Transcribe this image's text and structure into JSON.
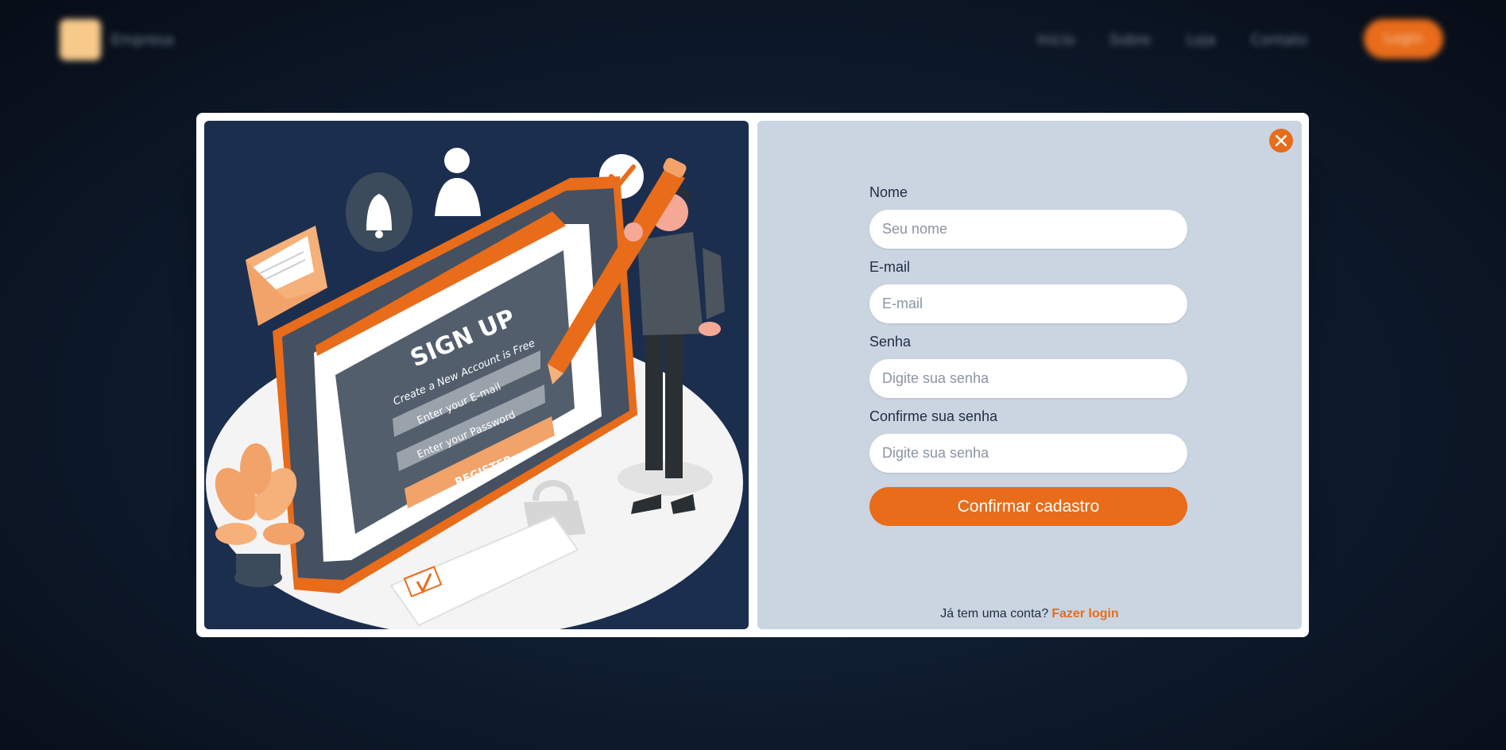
{
  "background_nav": {
    "brand": "Empresa",
    "links": [
      "Início",
      "Sobre",
      "Loja",
      "Contato"
    ],
    "login_label": "Login"
  },
  "illustration": {
    "heading": "SIGN UP",
    "subheading": "Create a New Account is Free",
    "email_placeholder": "Enter your E-mail",
    "password_placeholder": "Enter your Password",
    "register_label": "REGISTER"
  },
  "form": {
    "name_label": "Nome",
    "name_placeholder": "Seu nome",
    "email_label": "E-mail",
    "email_placeholder": "E-mail",
    "password_label": "Senha",
    "password_placeholder": "Digite sua senha",
    "confirm_label": "Confirme sua senha",
    "confirm_placeholder": "Digite sua senha",
    "submit_label": "Confirmar cadastro"
  },
  "footer": {
    "prompt": "Já tem uma conta?",
    "login_link": "Fazer login"
  },
  "colors": {
    "accent": "#e86c1a",
    "panel": "#cbd5e1",
    "illustration_bg": "#1c2e4e"
  },
  "icons": {
    "close": "close-icon"
  }
}
